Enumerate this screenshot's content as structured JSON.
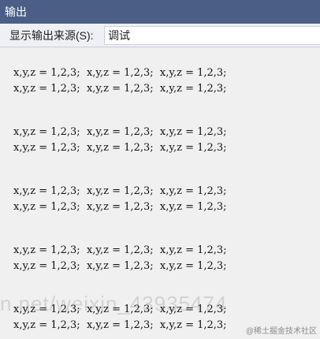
{
  "window": {
    "title": "输出"
  },
  "toolbar": {
    "source_label": "显示输出来源(S):",
    "source_value": "调试"
  },
  "output": {
    "lines": [
      "x,y,z = 1,2,3;  x,y,z = 1,2,3;  x,y,z = 1,2,3;",
      "x,y,z = 1,2,3;  x,y,z = 1,2,3;  x,y,z = 1,2,3;",
      "x,y,z = 1,2,3;  x,y,z = 1,2,3;  x,y,z = 1,2,3;",
      "x,y,z = 1,2,3;  x,y,z = 1,2,3;  x,y,z = 1,2,3;",
      "x,y,z = 1,2,3;  x,y,z = 1,2,3;  x,y,z = 1,2,3;",
      "x,y,z = 1,2,3;  x,y,z = 1,2,3;  x,y,z = 1,2,3;",
      "x,y,z = 1,2,3;  x,y,z = 1,2,3;  x,y,z = 1,2,3;",
      "x,y,z = 1,2,3;  x,y,z = 1,2,3;  x,y,z = 1,2,3;",
      "x,y,z = 1,2,3;  x,y,z = 1,2,3;  x,y,z = 1,2,3;",
      "x,y,z = 1,2,3;  x,y,z = 1,2,3;  x,y,z = 1,2,3;"
    ],
    "watermark": "n.net/weixin_43935474",
    "badge": "@稀土掘金技术社区"
  },
  "colors": {
    "titlebar": "#4b5f86",
    "panel": "#f0f0f0"
  }
}
